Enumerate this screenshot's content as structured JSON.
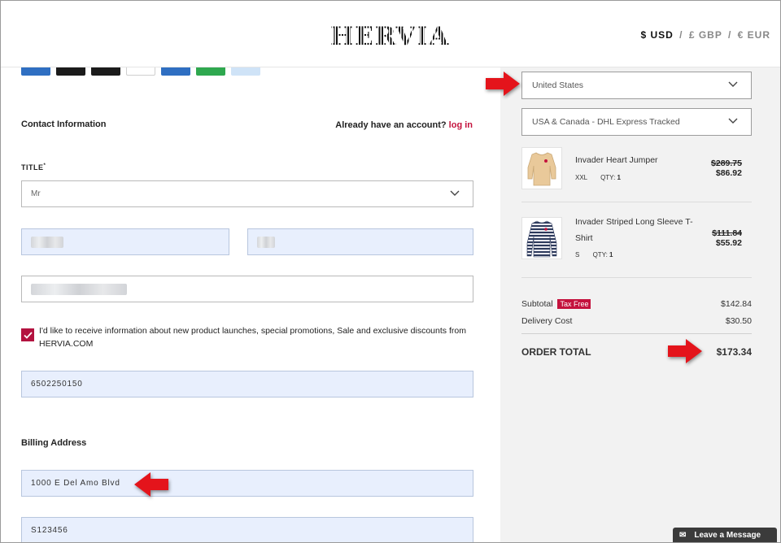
{
  "header": {
    "logo": "HERVIA",
    "currency": {
      "usd": "$ USD",
      "sep": "/",
      "gbp": "£ GBP",
      "eur": "€ EUR"
    }
  },
  "colors": {
    "accent": "#c4123d",
    "checkbox": "#b3123f",
    "filled_input": "#e8effd",
    "summary_bg": "#f2f2f2"
  },
  "payment_icons": [
    "bank-card-icon",
    "mastercard-icon",
    "maestro-icon",
    "visa-icon",
    "bancontact-icon",
    "wallet-icon",
    "applepay-icon"
  ],
  "contact": {
    "title": "Contact Information",
    "account_prompt": "Already have an account?",
    "login_link": "log in",
    "title_label": "TITLE",
    "required_mark": "*",
    "title_value": "Mr",
    "phone_value": "6502250150",
    "consent_text": "I'd like to receive information about new product launches, special promotions, Sale and exclusive discounts from HERVIA.COM",
    "consent_checked": true
  },
  "billing": {
    "title": "Billing Address",
    "address_value": "1000 E Del Amo Blvd",
    "address2_value": "S123456"
  },
  "summary": {
    "country": "United States",
    "shipping_method": "USA & Canada - DHL Express Tracked",
    "items": [
      {
        "name": "Invader Heart Jumper",
        "size": "XXL",
        "qty_label": "QTY:",
        "qty": "1",
        "old_price": "$289.75",
        "price": "$86.92"
      },
      {
        "name": "Invader Striped Long Sleeve T-Shirt",
        "size": "S",
        "qty_label": "QTY:",
        "qty": "1",
        "old_price": "$111.84",
        "price": "$55.92"
      }
    ],
    "subtotal_label": "Subtotal",
    "tax_badge": "Tax Free",
    "subtotal": "$142.84",
    "delivery_label": "Delivery Cost",
    "delivery": "$30.50",
    "total_label": "ORDER TOTAL",
    "total": "$173.34"
  },
  "chat": {
    "label": "Leave a Message"
  }
}
